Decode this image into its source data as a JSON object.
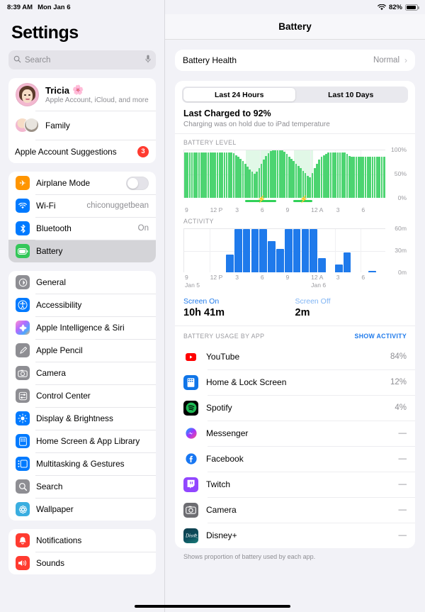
{
  "status_bar": {
    "time": "8:39 AM",
    "date": "Mon Jan 6",
    "wifi_icon": "wifi-icon",
    "battery_percent": "82%",
    "battery_icon": "battery-icon"
  },
  "sidebar": {
    "title": "Settings",
    "search": {
      "placeholder": "Search",
      "icon": "search-icon",
      "mic_icon": "microphone-icon"
    },
    "account": {
      "name": "Tricia",
      "emoji": "🌸",
      "subtitle": "Apple Account, iCloud, and more",
      "family_label": "Family",
      "suggestions_label": "Apple Account Suggestions",
      "suggestions_badge": "3"
    },
    "group_connectivity": [
      {
        "label": "Airplane Mode",
        "value": "",
        "icon": "airplane-icon",
        "color": "#ff9500",
        "control": "toggle-off"
      },
      {
        "label": "Wi-Fi",
        "value": "chiconuggetbean",
        "icon": "wifi-icon",
        "color": "#007aff",
        "control": ""
      },
      {
        "label": "Bluetooth",
        "value": "On",
        "icon": "bluetooth-icon",
        "color": "#007aff",
        "control": ""
      },
      {
        "label": "Battery",
        "value": "",
        "icon": "battery-icon",
        "color": "#34c759",
        "control": "",
        "selected": true
      }
    ],
    "group_system": [
      {
        "label": "General",
        "icon": "gear-icon",
        "color": "#8e8e93"
      },
      {
        "label": "Accessibility",
        "icon": "accessibility-icon",
        "color": "#007aff"
      },
      {
        "label": "Apple Intelligence & Siri",
        "icon": "siri-icon",
        "color": "gradient"
      },
      {
        "label": "Apple Pencil",
        "icon": "pencil-icon",
        "color": "#8e8e93"
      },
      {
        "label": "Camera",
        "icon": "camera-icon",
        "color": "#8e8e93"
      },
      {
        "label": "Control Center",
        "icon": "control-center-icon",
        "color": "#8e8e93"
      },
      {
        "label": "Display & Brightness",
        "icon": "brightness-icon",
        "color": "#007aff"
      },
      {
        "label": "Home Screen & App Library",
        "icon": "home-screen-icon",
        "color": "#007aff"
      },
      {
        "label": "Multitasking & Gestures",
        "icon": "multitasking-icon",
        "color": "#007aff"
      },
      {
        "label": "Search",
        "icon": "search-icon",
        "color": "#8e8e93"
      },
      {
        "label": "Wallpaper",
        "icon": "wallpaper-icon",
        "color": "#3aaee0"
      }
    ],
    "group_alerts": [
      {
        "label": "Notifications",
        "icon": "bell-icon",
        "color": "#ff3b30"
      },
      {
        "label": "Sounds",
        "icon": "speaker-icon",
        "color": "#ff3b30"
      }
    ]
  },
  "detail": {
    "nav_title": "Battery",
    "battery_health": {
      "label": "Battery Health",
      "value": "Normal",
      "chevron": "chevron-right-icon"
    },
    "segments": [
      {
        "label": "Last 24 Hours",
        "active": true
      },
      {
        "label": "Last 10 Days",
        "active": false
      }
    ],
    "last_charged": "Last Charged to 92%",
    "last_charged_sub": "Charging was on hold due to iPad temperature",
    "battery_level_header": "BATTERY LEVEL",
    "activity_header": "ACTIVITY",
    "screen_on": {
      "label": "Screen On",
      "value": "10h 41m"
    },
    "screen_off": {
      "label": "Screen Off",
      "value": "2m"
    },
    "usage_header": "BATTERY USAGE BY APP",
    "show_activity": "SHOW ACTIVITY",
    "apps": [
      {
        "name": "YouTube",
        "pct": "84%",
        "icon": "youtube-icon",
        "color": "#ff0000"
      },
      {
        "name": "Home & Lock Screen",
        "pct": "12%",
        "icon": "home-lock-screen-icon",
        "color": "#1075e8"
      },
      {
        "name": "Spotify",
        "pct": "4%",
        "icon": "spotify-icon",
        "color": "#1db954"
      },
      {
        "name": "Messenger",
        "pct": "—",
        "icon": "messenger-icon",
        "color": "#a033ff"
      },
      {
        "name": "Facebook",
        "pct": "—",
        "icon": "facebook-icon",
        "color": "#1877f2"
      },
      {
        "name": "Twitch",
        "pct": "—",
        "icon": "twitch-icon",
        "color": "#9146ff"
      },
      {
        "name": "Camera",
        "pct": "—",
        "icon": "camera-icon",
        "color": "#6d6d72"
      },
      {
        "name": "Disney+",
        "pct": "—",
        "icon": "disney-plus-icon",
        "color": "#0c4f5e"
      }
    ],
    "footnote": "Shows proportion of battery used by each app."
  },
  "chart_data": [
    {
      "type": "bar",
      "title": "BATTERY LEVEL",
      "ylabel": "",
      "xlabel": "",
      "ylim": [
        0,
        100
      ],
      "yticks": [
        "0%",
        "50%",
        "100%"
      ],
      "xticks": [
        "9",
        "12 P",
        "3",
        "6",
        "9",
        "12 A",
        "3",
        "6"
      ],
      "color": "#4cd471",
      "values": [
        96,
        96,
        96,
        96,
        96,
        96,
        96,
        96,
        96,
        96,
        96,
        96,
        96,
        96,
        96,
        96,
        96,
        96,
        96,
        96,
        96,
        94,
        90,
        86,
        82,
        77,
        72,
        66,
        60,
        55,
        51,
        55,
        63,
        72,
        80,
        88,
        94,
        98,
        100,
        100,
        100,
        100,
        100,
        97,
        92,
        87,
        82,
        77,
        72,
        67,
        62,
        57,
        52,
        47,
        44,
        52,
        62,
        72,
        80,
        86,
        90,
        93,
        95,
        95,
        95,
        95,
        95,
        95,
        95,
        95,
        92,
        88,
        86,
        86,
        86,
        86,
        86,
        86,
        86,
        86,
        86,
        86,
        86,
        86,
        86,
        86,
        86
      ],
      "charging_periods": [
        {
          "start_pct": 30.5,
          "width_pct": 15.5,
          "label": "charging"
        },
        {
          "start_pct": 54.5,
          "width_pct": 9.5,
          "label": "charging"
        }
      ]
    },
    {
      "type": "bar",
      "title": "ACTIVITY",
      "ylabel": "",
      "xlabel": "",
      "ylim": [
        0,
        60
      ],
      "yticks": [
        "0m",
        "30m",
        "60m"
      ],
      "xticks": [
        "9",
        "12 P",
        "3",
        "6",
        "9",
        "12 A",
        "3",
        "6"
      ],
      "day_labels": [
        "Jan 5",
        "Jan 6"
      ],
      "color": "#1f7aeb",
      "categories": [
        "9",
        "10",
        "11",
        "12P",
        "1",
        "2",
        "3",
        "4",
        "5",
        "6",
        "7",
        "8",
        "9",
        "10",
        "11",
        "12A",
        "1",
        "2",
        "3",
        "4",
        "5",
        "6",
        "7",
        "8"
      ],
      "values": [
        0,
        0,
        0,
        0,
        0,
        25,
        60,
        60,
        60,
        60,
        43,
        32,
        60,
        60,
        60,
        60,
        20,
        0,
        11,
        28,
        0,
        0,
        2,
        0
      ]
    }
  ]
}
